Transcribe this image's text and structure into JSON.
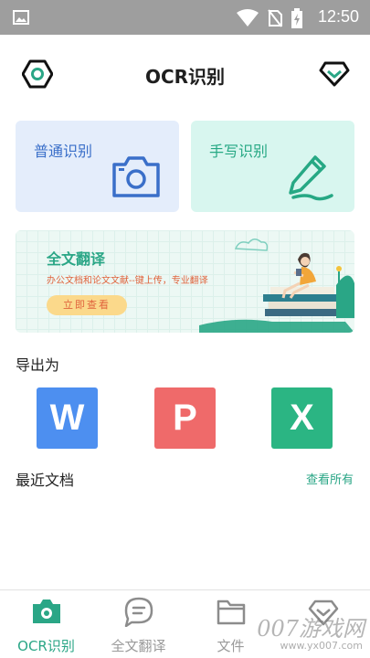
{
  "status_bar": {
    "time": "12:50",
    "bg_color": "#9e9e9e",
    "icons": [
      "gallery-icon",
      "wifi-icon",
      "no-sim-icon",
      "battery-charging-icon"
    ]
  },
  "header": {
    "title": "OCR识别",
    "left_icon": "hexagon-settings-icon",
    "right_icon": "diamond-vip-icon"
  },
  "cards": {
    "ocr": {
      "label": "普通识别",
      "icon": "camera-icon",
      "bg": "#e4edfb"
    },
    "handwriting": {
      "label": "手写识别",
      "icon": "pen-icon",
      "bg": "#d8f6ef"
    }
  },
  "banner": {
    "title": "全文翻译",
    "subtitle": "办公文档和论文文献--键上传，专业翻译",
    "button": "立即查看"
  },
  "export": {
    "title": "导出为",
    "buttons": [
      {
        "letter": "W",
        "color": "#4d8ff0"
      },
      {
        "letter": "P",
        "color": "#ef6a6a"
      },
      {
        "letter": "X",
        "color": "#2bb583"
      }
    ]
  },
  "recent": {
    "title": "最近文档",
    "see_all": "查看所有"
  },
  "tabbar": {
    "active_color": "#2aa686",
    "tabs": [
      {
        "label": "OCR识别",
        "icon": "camera-tab-icon",
        "active": true
      },
      {
        "label": "全文翻译",
        "icon": "chat-bubble-icon",
        "active": false
      },
      {
        "label": "文件",
        "icon": "folder-icon",
        "active": false
      },
      {
        "label": "",
        "icon": "diamond-icon",
        "active": false
      }
    ]
  },
  "watermark": {
    "brand": "007游戏网",
    "url": "www.yx007.com"
  }
}
